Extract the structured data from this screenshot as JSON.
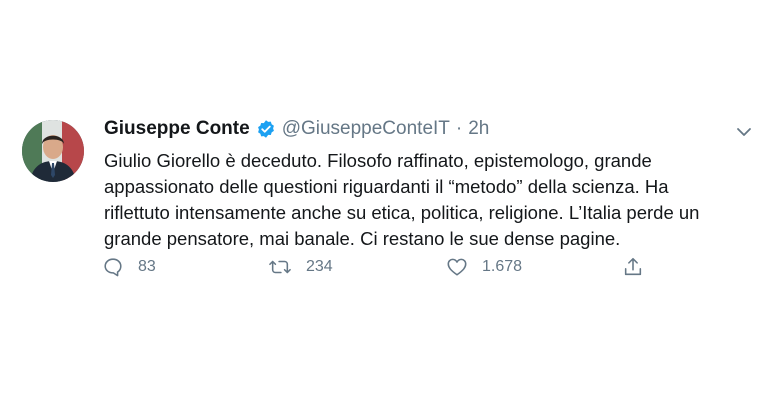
{
  "tweet": {
    "display_name": "Giuseppe Conte",
    "handle": "@GiuseppeConteIT",
    "separator": "·",
    "time": "2h",
    "text": "Giulio Giorello è deceduto. Filosofo raffinato, epistemologo, grande\nappassionato delle questioni riguardanti il “metodo” della scienza. Ha\nriflettuto intensamente anche su etica, politica, religione. L’Italia perde un\ngrande pensatore, mai banale. Ci restano le sue dense pagine.",
    "replies": "83",
    "retweets": "234",
    "likes": "1.678"
  },
  "icons": {
    "verified": "verified-badge-icon",
    "menu": "chevron-down-icon",
    "reply": "comment-icon",
    "retweet": "retweet-icon",
    "like": "heart-icon",
    "share": "share-icon"
  },
  "colors": {
    "verified": "#1da1f2",
    "secondary_text": "#657786",
    "primary_text": "#14171a"
  }
}
